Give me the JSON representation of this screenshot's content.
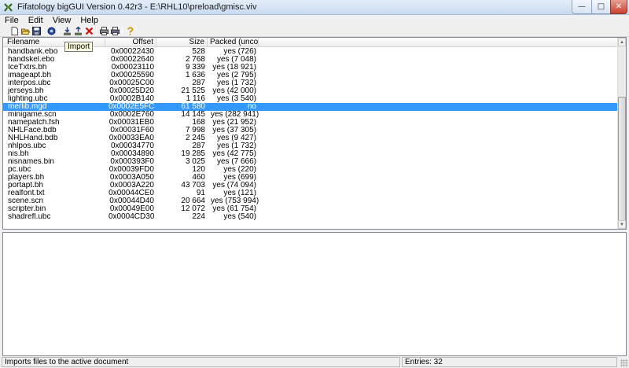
{
  "window": {
    "title": "Fifatology bigGUI Version 0.42r3 - E:\\RHL10\\preload\\gmisc.viv"
  },
  "menu": [
    "File",
    "Edit",
    "View",
    "Help"
  ],
  "tooltip": "Import",
  "columns": {
    "filename": "Filename",
    "offset": "Offset",
    "size": "Size",
    "packed": "Packed (unco..."
  },
  "rows": [
    {
      "name": "handbank.ebo",
      "offset": "0x00022430",
      "size": "528",
      "packed": "yes (726)"
    },
    {
      "name": "handskel.ebo",
      "offset": "0x00022640",
      "size": "2 768",
      "packed": "yes (7 048)"
    },
    {
      "name": "IceTxtrs.bh",
      "offset": "0x00023110",
      "size": "9 339",
      "packed": "yes (18 921)"
    },
    {
      "name": "imageapt.bh",
      "offset": "0x00025590",
      "size": "1 636",
      "packed": "yes (2 795)"
    },
    {
      "name": "interpos.ubc",
      "offset": "0x00025C00",
      "size": "287",
      "packed": "yes (1 732)"
    },
    {
      "name": "jerseys.bh",
      "offset": "0x00025D20",
      "size": "21 525",
      "packed": "yes (42 000)"
    },
    {
      "name": "lighting.ubc",
      "offset": "0x0002B140",
      "size": "1 116",
      "packed": "yes (3 540)"
    },
    {
      "name": "merlib.mgd",
      "offset": "0x0002E5FC",
      "size": "61 580",
      "packed": "no",
      "selected": true
    },
    {
      "name": "minigame.scn",
      "offset": "0x0002E760",
      "size": "14 145",
      "packed": "yes (282 941)"
    },
    {
      "name": "namepatch.fsh",
      "offset": "0x00031EB0",
      "size": "168",
      "packed": "yes (21 952)"
    },
    {
      "name": "NHLFace.bdb",
      "offset": "0x00031F60",
      "size": "7 998",
      "packed": "yes (37 305)"
    },
    {
      "name": "NHLHand.bdb",
      "offset": "0x00033EA0",
      "size": "2 245",
      "packed": "yes (9 427)"
    },
    {
      "name": "nhlpos.ubc",
      "offset": "0x00034770",
      "size": "287",
      "packed": "yes (1 732)"
    },
    {
      "name": "nis.bh",
      "offset": "0x00034890",
      "size": "19 285",
      "packed": "yes (42 775)"
    },
    {
      "name": "nisnames.bin",
      "offset": "0x000393F0",
      "size": "3 025",
      "packed": "yes (7 666)"
    },
    {
      "name": "pc.ubc",
      "offset": "0x00039FD0",
      "size": "120",
      "packed": "yes (220)"
    },
    {
      "name": "players.bh",
      "offset": "0x0003A050",
      "size": "460",
      "packed": "yes (699)"
    },
    {
      "name": "portapt.bh",
      "offset": "0x0003A220",
      "size": "43 703",
      "packed": "yes (74 094)"
    },
    {
      "name": "realfont.txt",
      "offset": "0x00044CE0",
      "size": "91",
      "packed": "yes (121)"
    },
    {
      "name": "scene.scn",
      "offset": "0x00044D40",
      "size": "20 664",
      "packed": "yes (753 994)"
    },
    {
      "name": "scripter.bin",
      "offset": "0x00049E00",
      "size": "12 072",
      "packed": "yes (61 754)"
    },
    {
      "name": "shadrefl.ubc",
      "offset": "0x0004CD30",
      "size": "224",
      "packed": "yes (540)"
    }
  ],
  "status": {
    "message": "Imports files to the active document",
    "entries": "Entries: 32"
  },
  "toolbar_icons": [
    "new-icon",
    "open-icon",
    "save-icon",
    "properties-icon",
    "import-icon",
    "export-icon",
    "delete-icon",
    "print-icon",
    "print-preview-icon",
    "help-icon"
  ]
}
